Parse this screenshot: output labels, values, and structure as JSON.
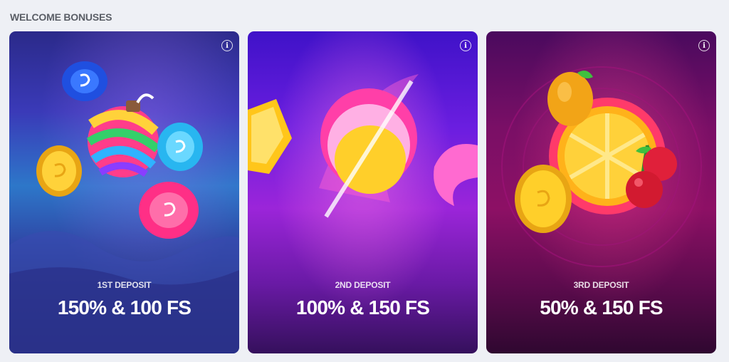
{
  "section": {
    "title": "WELCOME BONUSES"
  },
  "cards": [
    {
      "label": "1ST DEPOSIT",
      "amount": "150% & 100 FS"
    },
    {
      "label": "2ND DEPOSIT",
      "amount": "100% & 150 FS"
    },
    {
      "label": "3RD DEPOSIT",
      "amount": "50% & 150 FS"
    }
  ],
  "info_icon_glyph": "i",
  "icons": {
    "card_1": [
      "blue-chip-icon",
      "bomb-candy-icon",
      "gold-coin-icon",
      "cyan-chip-icon",
      "pink-chip-icon"
    ],
    "card_2": [
      "gold-candy-icon",
      "pink-coin-icon",
      "pink-jelly-icon"
    ],
    "card_3": [
      "orange-icon",
      "fortune-wheel-icon",
      "gold-coin-icon",
      "cherries-icon"
    ]
  }
}
